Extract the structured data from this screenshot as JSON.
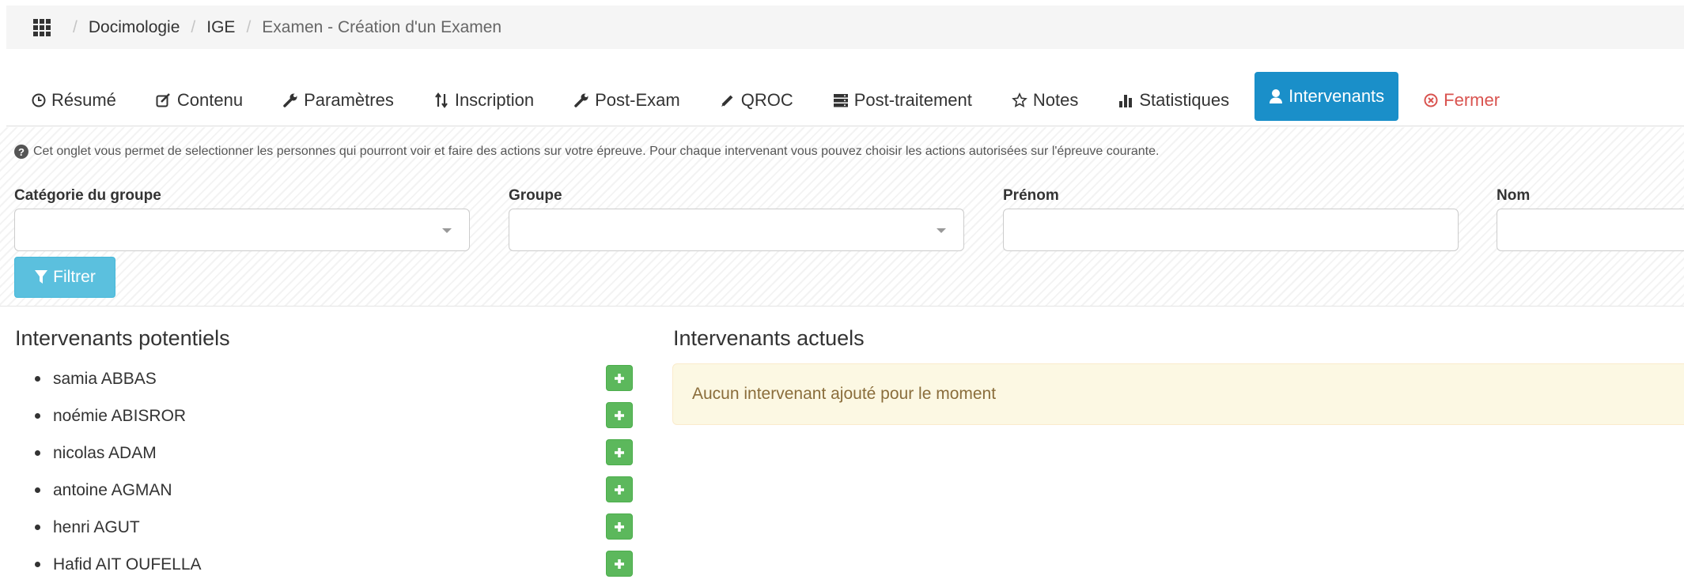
{
  "breadcrumb": {
    "items": [
      "Docimologie",
      "IGE",
      "Examen - Création d'un Examen"
    ],
    "separator": "/"
  },
  "tabs": [
    {
      "label": "Résumé",
      "icon": "clock-icon"
    },
    {
      "label": "Contenu",
      "icon": "edit-icon"
    },
    {
      "label": "Paramètres",
      "icon": "wrench-icon"
    },
    {
      "label": "Inscription",
      "icon": "sort-icon"
    },
    {
      "label": "Post-Exam",
      "icon": "wrench-icon"
    },
    {
      "label": "QROC",
      "icon": "pencil-icon"
    },
    {
      "label": "Post-traitement",
      "icon": "server-icon"
    },
    {
      "label": "Notes",
      "icon": "star-icon"
    },
    {
      "label": "Statistiques",
      "icon": "bar-chart-icon"
    },
    {
      "label": "Intervenants",
      "icon": "user-icon",
      "active": true
    },
    {
      "label": "Fermer",
      "icon": "circle-x-icon"
    }
  ],
  "info_text": "Cet onglet vous permet de selectionner les personnes qui pourront voir et faire des actions sur votre épreuve. Pour chaque intervenant vous pouvez choisir les actions autorisées sur l'épreuve courante.",
  "filters": {
    "category_label": "Catégorie du groupe",
    "category_value": "",
    "group_label": "Groupe",
    "group_value": "",
    "firstname_label": "Prénom",
    "firstname_value": "",
    "lastname_label": "Nom",
    "lastname_value": "",
    "filter_button": "Filtrer"
  },
  "potential": {
    "title": "Intervenants potentiels",
    "items": [
      "samia ABBAS",
      "noémie ABISROR",
      "nicolas ADAM",
      "antoine AGMAN",
      "henri AGUT",
      "Hafid AIT OUFELLA"
    ]
  },
  "current": {
    "title": "Intervenants actuels",
    "empty_message": "Aucun intervenant ajouté pour le moment"
  },
  "colors": {
    "active_tab": "#1a8fc9",
    "close_tab": "#d9534f",
    "filter_button": "#5bc0de",
    "add_button": "#5cb85c",
    "alert_bg": "#fcf8e3",
    "alert_text": "#8a6d3b"
  }
}
